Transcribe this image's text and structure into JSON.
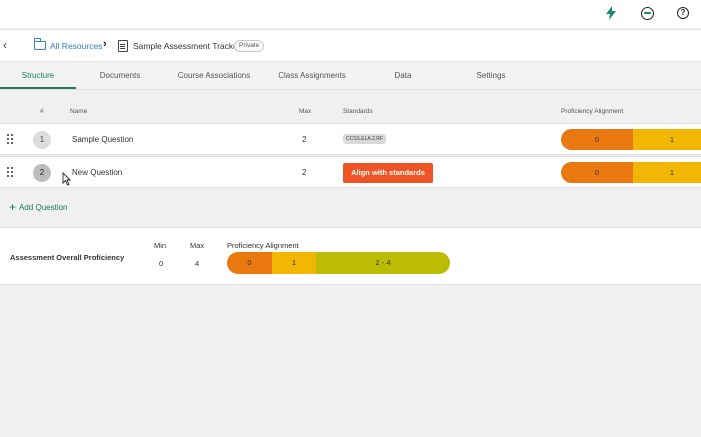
{
  "header": {
    "icons": [
      "lightning-icon",
      "avatar-icon",
      "help-icon"
    ]
  },
  "breadcrumb": {
    "root_label": "All Resources",
    "title": "Sample Assessment Tracker",
    "badge": "Private"
  },
  "tabs": [
    {
      "label": "Structure",
      "active": true
    },
    {
      "label": "Documents",
      "active": false
    },
    {
      "label": "Course Associations",
      "active": false
    },
    {
      "label": "Class Assignments",
      "active": false
    },
    {
      "label": "Data",
      "active": false
    },
    {
      "label": "Settings",
      "active": false
    }
  ],
  "table": {
    "columns": {
      "num": "#",
      "name": "Name",
      "max": "Max",
      "standards": "Standards",
      "proficiency": "Proficiency Alignment"
    },
    "rows": [
      {
        "num": "1",
        "name": "Sample Question",
        "max": "2",
        "standard": "CCSS.ELA.2.RF",
        "prof": [
          "0",
          "1"
        ]
      },
      {
        "num": "2",
        "name": "New Question",
        "max": "2",
        "action": "Align with standards",
        "prof": [
          "0",
          "1"
        ]
      }
    ]
  },
  "add_question": "Add Question",
  "overall": {
    "label": "Assessment Overall Proficiency",
    "min_label": "Min",
    "max_label": "Max",
    "alignment_label": "Proficiency Alignment",
    "min": "0",
    "max": "4",
    "segments": [
      "0",
      "1",
      "2 - 4"
    ]
  },
  "colors": {
    "accent": "#1a7a63",
    "link": "#2f7dc1",
    "orange": "#e8780f",
    "yellow": "#f2b705",
    "olive": "#bdbc05",
    "button": "#ee5426"
  }
}
